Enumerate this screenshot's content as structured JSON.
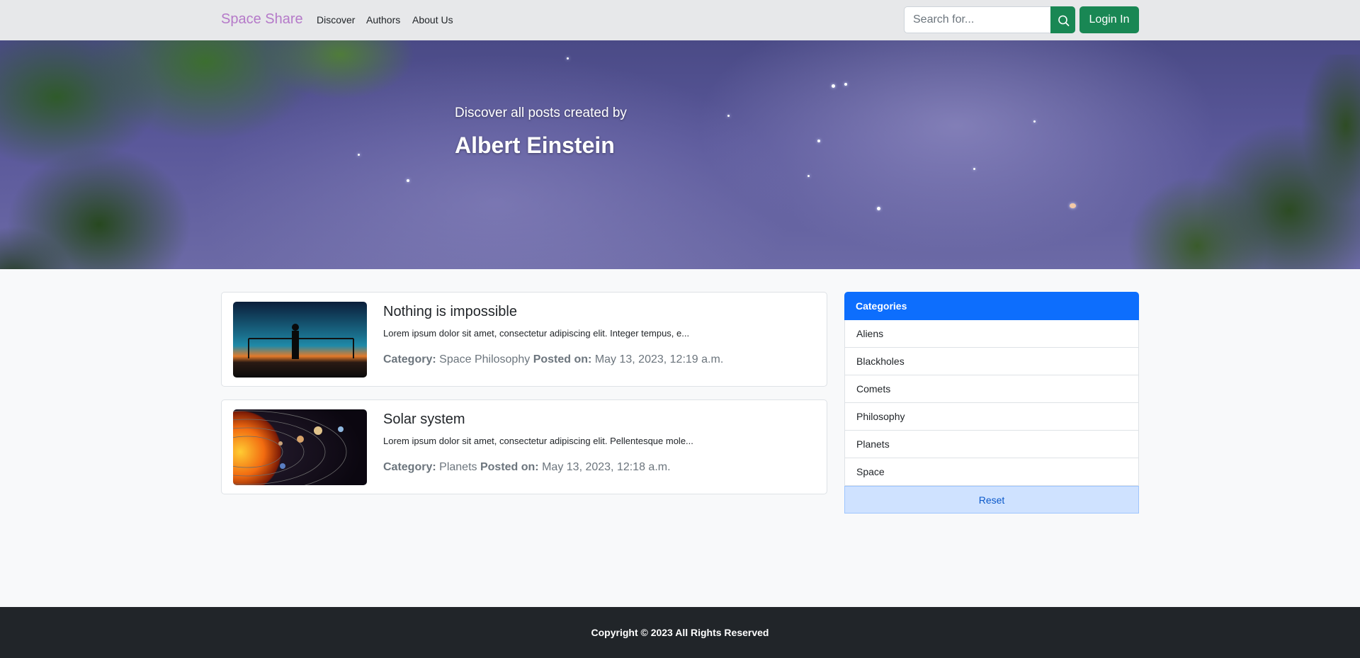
{
  "navbar": {
    "brand": "Space Share",
    "links": [
      "Discover",
      "Authors",
      "About Us"
    ],
    "search_placeholder": "Search for...",
    "login_label": "Login In"
  },
  "hero": {
    "subtitle": "Discover all posts created by",
    "author": "Albert Einstein"
  },
  "posts": [
    {
      "title": "Nothing is impossible",
      "excerpt": "Lorem ipsum dolor sit amet, consectetur adipiscing elit. Integer tempus, e...",
      "category_label": "Category:",
      "category": "Space Philosophy",
      "posted_label": "Posted on:",
      "posted_on": "May 13, 2023, 12:19 a.m."
    },
    {
      "title": "Solar system",
      "excerpt": "Lorem ipsum dolor sit amet, consectetur adipiscing elit. Pellentesque mole...",
      "category_label": "Category:",
      "category": "Planets",
      "posted_label": "Posted on:",
      "posted_on": "May 13, 2023, 12:18 a.m."
    }
  ],
  "sidebar": {
    "header": "Categories",
    "items": [
      "Aliens",
      "Blackholes",
      "Comets",
      "Philosophy",
      "Planets",
      "Space"
    ],
    "reset_label": "Reset"
  },
  "footer": {
    "copyright": "Copyright © 2023 All Rights Reserved"
  },
  "colors": {
    "brand": "#b57ac9",
    "success": "#198754",
    "primary": "#0d6efd",
    "footer_bg": "#212529"
  },
  "icons": {
    "search_button": "search-icon"
  }
}
